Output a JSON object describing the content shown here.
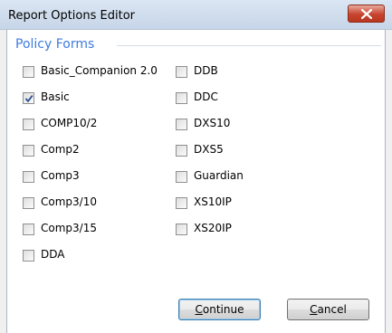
{
  "window": {
    "title": "Report Options Editor",
    "close_icon": "close-icon"
  },
  "group": {
    "title": "Policy Forms"
  },
  "checkboxes": {
    "left": [
      {
        "label": "Basic_Companion 2.0",
        "checked": false
      },
      {
        "label": "Basic",
        "checked": true
      },
      {
        "label": "COMP10/2",
        "checked": false
      },
      {
        "label": "Comp2",
        "checked": false
      },
      {
        "label": "Comp3",
        "checked": false
      },
      {
        "label": "Comp3/10",
        "checked": false
      },
      {
        "label": "Comp3/15",
        "checked": false
      },
      {
        "label": "DDA",
        "checked": false
      }
    ],
    "right": [
      {
        "label": "DDB",
        "checked": false
      },
      {
        "label": "DDC",
        "checked": false
      },
      {
        "label": "DXS10",
        "checked": false
      },
      {
        "label": "DXS5",
        "checked": false
      },
      {
        "label": "Guardian",
        "checked": false
      },
      {
        "label": "XS10IP",
        "checked": false
      },
      {
        "label": "XS20IP",
        "checked": false
      }
    ]
  },
  "buttons": {
    "continue_accel": "C",
    "continue_rest": "ontinue",
    "cancel_accel": "C",
    "cancel_rest": "ancel"
  },
  "colors": {
    "accent": "#3c7ce0",
    "close_red": "#c7442f"
  }
}
